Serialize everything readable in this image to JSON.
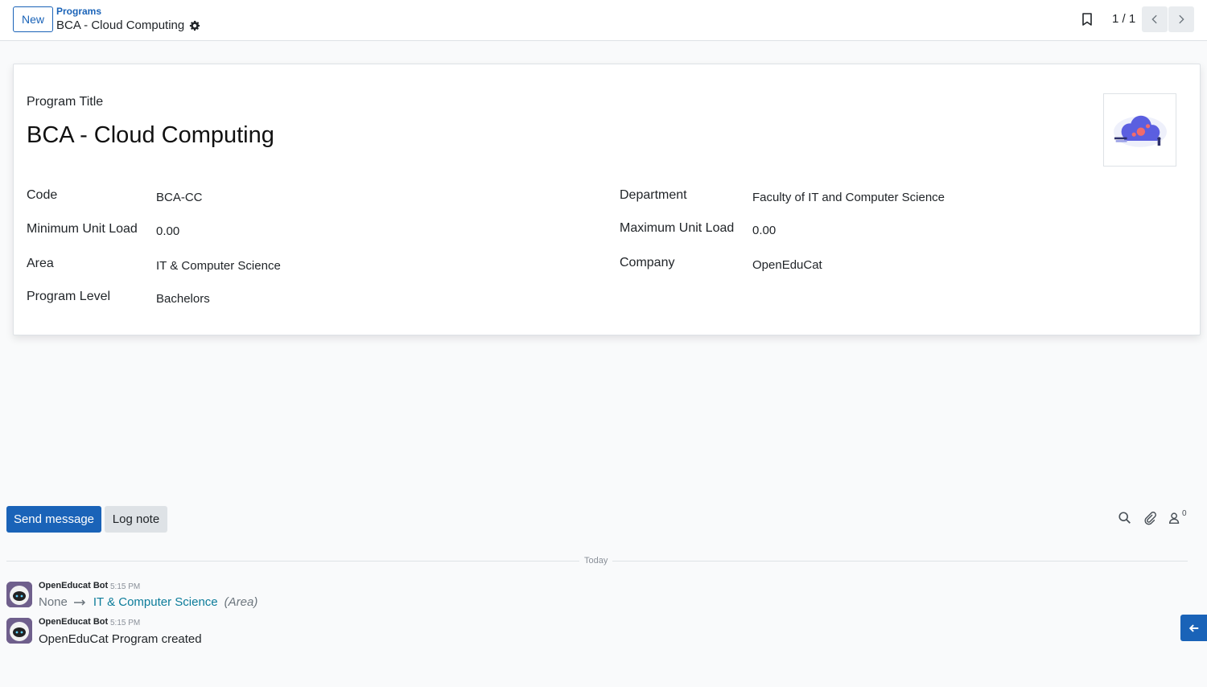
{
  "control_panel": {
    "new_label": "New",
    "breadcrumb_parent": "Programs",
    "breadcrumb_current": "BCA - Cloud Computing",
    "pager_value": "1 / 1"
  },
  "form": {
    "title_label": "Program Title",
    "title_value": "BCA - Cloud Computing",
    "fields_left": [
      {
        "label": "Code",
        "value": "BCA-CC"
      },
      {
        "label": "Minimum Unit Load",
        "value": "0.00"
      },
      {
        "label": "Area",
        "value": "IT & Computer Science"
      },
      {
        "label": "Program Level",
        "value": "Bachelors"
      }
    ],
    "fields_right": [
      {
        "label": "Department",
        "value": "Faculty of IT and Computer Science"
      },
      {
        "label": "Maximum Unit Load",
        "value": "0.00"
      },
      {
        "label": "Company",
        "value": "OpenEduCat"
      }
    ]
  },
  "chatter": {
    "send_message_label": "Send message",
    "log_note_label": "Log note",
    "follower_count": "0",
    "date_separator": "Today",
    "messages": [
      {
        "author": "OpenEducat Bot",
        "time": "5:15 PM",
        "old_value": "None",
        "new_value": "IT & Computer Science",
        "field_name": "(Area)"
      },
      {
        "author": "OpenEducat Bot",
        "time": "5:15 PM",
        "body": "OpenEduCat Program created"
      }
    ]
  },
  "colors": {
    "primary": "#1a63b8",
    "link_teal": "#0c7c9a",
    "background": "#f9fafb"
  },
  "icons": [
    "gear-icon",
    "bookmark-icon",
    "chevron-left-icon",
    "chevron-right-icon",
    "search-icon",
    "paperclip-icon",
    "user-icon",
    "arrow-right-icon",
    "arrow-left-icon"
  ]
}
